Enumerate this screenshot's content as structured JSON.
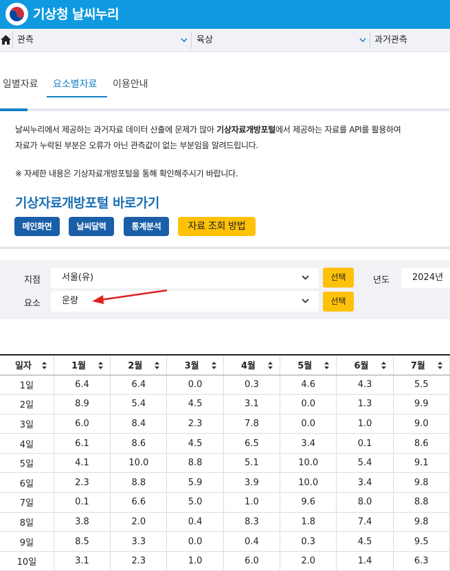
{
  "header": {
    "brand": "기상청 날씨누리"
  },
  "nav": {
    "items": [
      {
        "label": "관측"
      },
      {
        "label": "육상"
      },
      {
        "label": "과거관측"
      }
    ]
  },
  "tabs": [
    {
      "label": "일별자료",
      "active": false
    },
    {
      "label": "요소별자료",
      "active": true
    },
    {
      "label": "이용안내",
      "active": false
    }
  ],
  "notice": {
    "line1_a": "날씨누리에서 제공하는 과거자료 데이터 산출에 문제가 많아 ",
    "line1_b": "기상자료개방포털",
    "line1_c": "에서 제공하는 자료를 API를 활용하여",
    "line2": "자료가 누락된 부분은 오류가 아닌 관측값이 없는 부분임을 알려드립니다.",
    "line3": "※ 자세한 내용은 기상자료개방포털을 통해 확인해주시기 바랍니다."
  },
  "portal": {
    "title": "기상자료개방포털 바로가기",
    "buttons": [
      "메인화면",
      "날씨달력",
      "통계분석"
    ],
    "help_button": "자료 조회 방법"
  },
  "search": {
    "station_label": "지점",
    "station_value": "서울(유)",
    "element_label": "요소",
    "element_value": "운량",
    "select_button": "선택",
    "year_label": "년도",
    "year_value": "2024년"
  },
  "table": {
    "headers": [
      "일자",
      "1월",
      "2월",
      "3월",
      "4월",
      "5월",
      "6월",
      "7월"
    ],
    "rows": [
      [
        "1일",
        "6.4",
        "6.4",
        "0.0",
        "0.3",
        "4.6",
        "4.3",
        "5.5"
      ],
      [
        "2일",
        "8.9",
        "5.4",
        "4.5",
        "3.1",
        "0.0",
        "1.3",
        "9.9"
      ],
      [
        "3일",
        "6.0",
        "8.4",
        "2.3",
        "7.8",
        "0.0",
        "1.0",
        "9.0"
      ],
      [
        "4일",
        "6.1",
        "8.6",
        "4.5",
        "6.5",
        "3.4",
        "0.1",
        "8.6"
      ],
      [
        "5일",
        "4.1",
        "10.0",
        "8.8",
        "5.1",
        "10.0",
        "5.4",
        "9.1"
      ],
      [
        "6일",
        "2.3",
        "8.8",
        "5.9",
        "3.9",
        "10.0",
        "3.4",
        "9.8"
      ],
      [
        "7일",
        "0.1",
        "6.6",
        "5.0",
        "1.0",
        "9.6",
        "8.0",
        "8.8"
      ],
      [
        "8일",
        "3.8",
        "2.0",
        "0.4",
        "8.3",
        "1.8",
        "7.4",
        "9.8"
      ],
      [
        "9일",
        "8.5",
        "3.3",
        "0.0",
        "0.4",
        "0.3",
        "4.5",
        "9.5"
      ],
      [
        "10일",
        "3.1",
        "2.3",
        "1.0",
        "6.0",
        "2.0",
        "1.4",
        "6.3"
      ]
    ]
  },
  "colors": {
    "header_bg": "#0f9ae0",
    "accent_blue": "#1580c6",
    "button_blue": "#1a5fa8",
    "button_yellow": "#ffc107",
    "annotation_arrow": "#e02020"
  },
  "icons": {
    "home": "home-icon",
    "chevron": "chevron-down-icon",
    "sort": "sort-icon",
    "logo": "taegeuk-logo-icon"
  }
}
